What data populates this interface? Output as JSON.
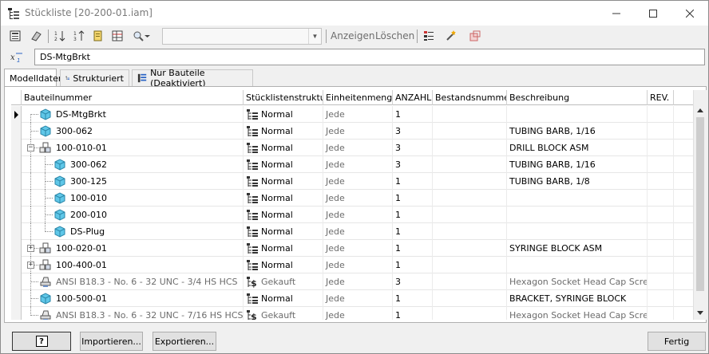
{
  "window": {
    "title": "Stückliste [20-200-01.iam]"
  },
  "toolbar": {
    "view_label": "Anzeigen",
    "delete_label": "Löschen",
    "combo_value": ""
  },
  "formula": {
    "value": "DS-MtgBrkt"
  },
  "tabs": [
    {
      "label": "Modelldaten"
    },
    {
      "label": "Strukturiert"
    },
    {
      "label": "Nur Bauteile (Deaktiviert)"
    }
  ],
  "columns": [
    "Bauteilnummer",
    "Stücklistenstruktur",
    "Einheitenmenge",
    "ANZAHL",
    "Bestandsnummer",
    "Beschreibung",
    "REV."
  ],
  "rows": [
    {
      "part": "DS-MtgBrkt",
      "structure": "Normal",
      "unit": "Jede",
      "qty": "1",
      "stock": "",
      "desc": "",
      "rev": "",
      "level": 0,
      "kind": "part",
      "expander": "",
      "muted": false
    },
    {
      "part": "300-062",
      "structure": "Normal",
      "unit": "Jede",
      "qty": "3",
      "stock": "",
      "desc": "TUBING BARB, 1/16",
      "rev": "",
      "level": 0,
      "kind": "part",
      "expander": "",
      "muted": false
    },
    {
      "part": "100-010-01",
      "structure": "Normal",
      "unit": "Jede",
      "qty": "3",
      "stock": "",
      "desc": "DRILL BLOCK ASM",
      "rev": "",
      "level": 0,
      "kind": "asm",
      "expander": "−",
      "muted": false
    },
    {
      "part": "300-062",
      "structure": "Normal",
      "unit": "Jede",
      "qty": "3",
      "stock": "",
      "desc": "TUBING BARB, 1/16",
      "rev": "",
      "level": 1,
      "kind": "part",
      "expander": "",
      "muted": false
    },
    {
      "part": "300-125",
      "structure": "Normal",
      "unit": "Jede",
      "qty": "1",
      "stock": "",
      "desc": "TUBING BARB, 1/8",
      "rev": "",
      "level": 1,
      "kind": "part",
      "expander": "",
      "muted": false
    },
    {
      "part": "100-010",
      "structure": "Normal",
      "unit": "Jede",
      "qty": "1",
      "stock": "",
      "desc": "",
      "rev": "",
      "level": 1,
      "kind": "part",
      "expander": "",
      "muted": false
    },
    {
      "part": "200-010",
      "structure": "Normal",
      "unit": "Jede",
      "qty": "1",
      "stock": "",
      "desc": "",
      "rev": "",
      "level": 1,
      "kind": "part",
      "expander": "",
      "muted": false
    },
    {
      "part": "DS-Plug",
      "structure": "Normal",
      "unit": "Jede",
      "qty": "1",
      "stock": "",
      "desc": "",
      "rev": "",
      "level": 1,
      "kind": "part",
      "expander": "",
      "muted": false
    },
    {
      "part": "100-020-01",
      "structure": "Normal",
      "unit": "Jede",
      "qty": "1",
      "stock": "",
      "desc": "SYRINGE BLOCK ASM",
      "rev": "",
      "level": 0,
      "kind": "asm",
      "expander": "+",
      "muted": false
    },
    {
      "part": "100-400-01",
      "structure": "Normal",
      "unit": "Jede",
      "qty": "1",
      "stock": "",
      "desc": "",
      "rev": "",
      "level": 0,
      "kind": "asm",
      "expander": "+",
      "muted": false
    },
    {
      "part": "ANSI B18.3 - No. 6 - 32 UNC - 3/4 HS HCS",
      "structure": "Gekauft",
      "unit": "Jede",
      "qty": "3",
      "stock": "",
      "desc": "Hexagon Socket Head Cap Screw",
      "rev": "",
      "level": 0,
      "kind": "cc",
      "expander": "",
      "muted": true
    },
    {
      "part": "100-500-01",
      "structure": "Normal",
      "unit": "Jede",
      "qty": "1",
      "stock": "",
      "desc": "BRACKET, SYRINGE BLOCK",
      "rev": "",
      "level": 0,
      "kind": "part",
      "expander": "",
      "muted": false
    },
    {
      "part": "ANSI B18.3 - No. 6 - 32 UNC - 7/16 HS HCS",
      "structure": "Gekauft",
      "unit": "Jede",
      "qty": "1",
      "stock": "",
      "desc": "Hexagon Socket Head Cap Screw",
      "rev": "",
      "level": 0,
      "kind": "cc",
      "expander": "",
      "muted": true
    }
  ],
  "buttons": {
    "help": "?",
    "import": "Importieren...",
    "export": "Exportieren...",
    "done": "Fertig"
  }
}
